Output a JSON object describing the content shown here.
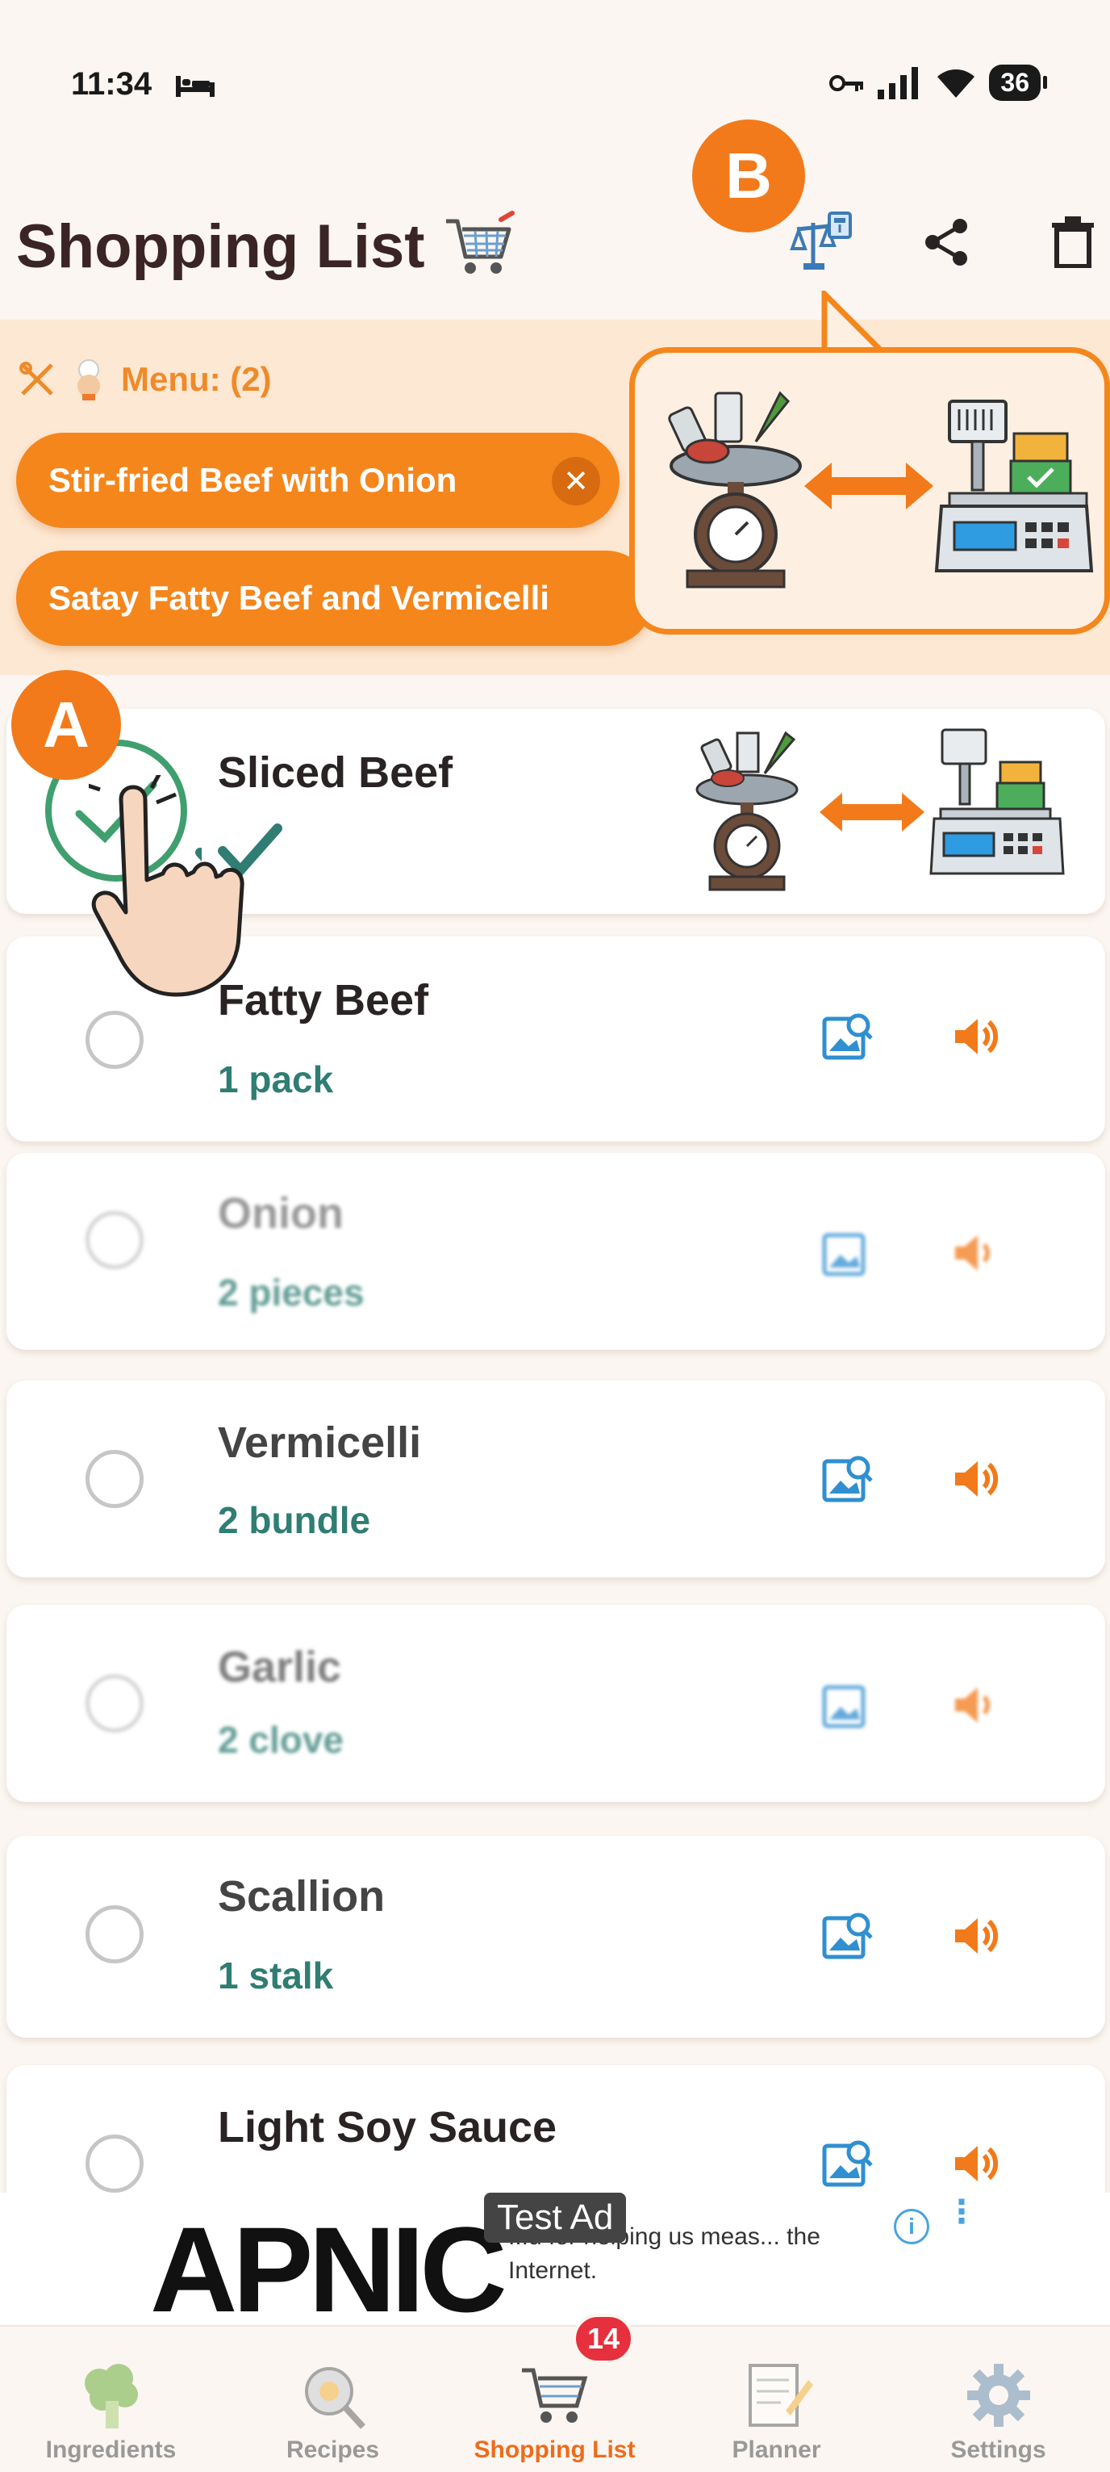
{
  "status_bar": {
    "time": "11:34",
    "battery": "36"
  },
  "header": {
    "title": "Shopping List"
  },
  "markers": {
    "a": "A",
    "b": "B"
  },
  "menu": {
    "label": "Menu: (2)",
    "chips": [
      {
        "label": "Stir-fried Beef with Onion"
      },
      {
        "label": "Satay Fatty Beef and Vermicelli"
      }
    ]
  },
  "items": [
    {
      "name": "Sliced Beef",
      "qty": ""
    },
    {
      "name": "Fatty Beef",
      "qty": "1 pack"
    },
    {
      "name": "Onion",
      "qty": "2 pieces"
    },
    {
      "name": "Vermicelli",
      "qty": "2 bundle"
    },
    {
      "name": "Garlic",
      "qty": "2 clove"
    },
    {
      "name": "Scallion",
      "qty": "1 stalk"
    },
    {
      "name": "Light Soy Sauce",
      "qty": ""
    }
  ],
  "ad": {
    "tag": "Test Ad",
    "logo": "APNIC",
    "text": "...u for helping us meas... the Internet."
  },
  "nav": {
    "ingredients": "Ingredients",
    "recipes": "Recipes",
    "shopping_list": "Shopping List",
    "planner": "Planner",
    "settings": "Settings",
    "badge": "14"
  },
  "colors": {
    "accent": "#f5861c",
    "teal": "#2f7d73",
    "badge": "#e6303e"
  }
}
